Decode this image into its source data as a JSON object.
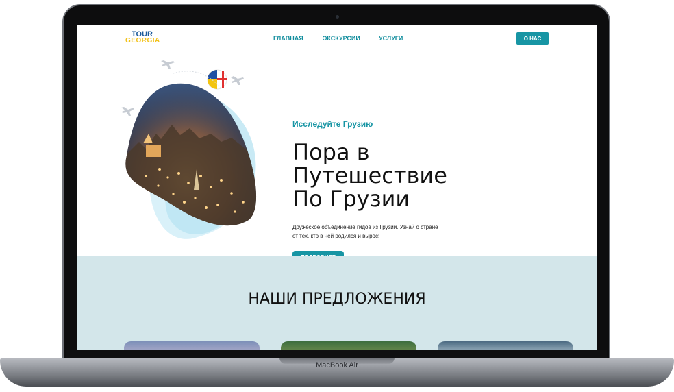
{
  "device": {
    "model_label": "MacBook Air"
  },
  "header": {
    "logo_top": "TOUR",
    "logo_bottom": "GEORGIA",
    "nav": [
      {
        "label": "ГЛАВНАЯ"
      },
      {
        "label": "ЭКСКУРСИИ"
      },
      {
        "label": "УСЛУГИ"
      }
    ],
    "about_button": "О НАС"
  },
  "hero": {
    "subtitle": "Исследуйте Грузию",
    "title_lines": [
      "Пора в",
      "Путешествие",
      "По Грузии"
    ],
    "description": "Дружеское объединение гидов из Грузии. Узнай о стране от тех, кто в ней родился и вырос!",
    "more_button": "ПОДРОБНЕЕ"
  },
  "offers": {
    "title": "НАШИ ПРЕДЛОЖЕНИЯ"
  },
  "colors": {
    "accent": "#1795a4",
    "offers_bg": "#d3e6ea",
    "logo_blue": "#1b5a9b",
    "logo_yellow": "#f2c21b"
  }
}
